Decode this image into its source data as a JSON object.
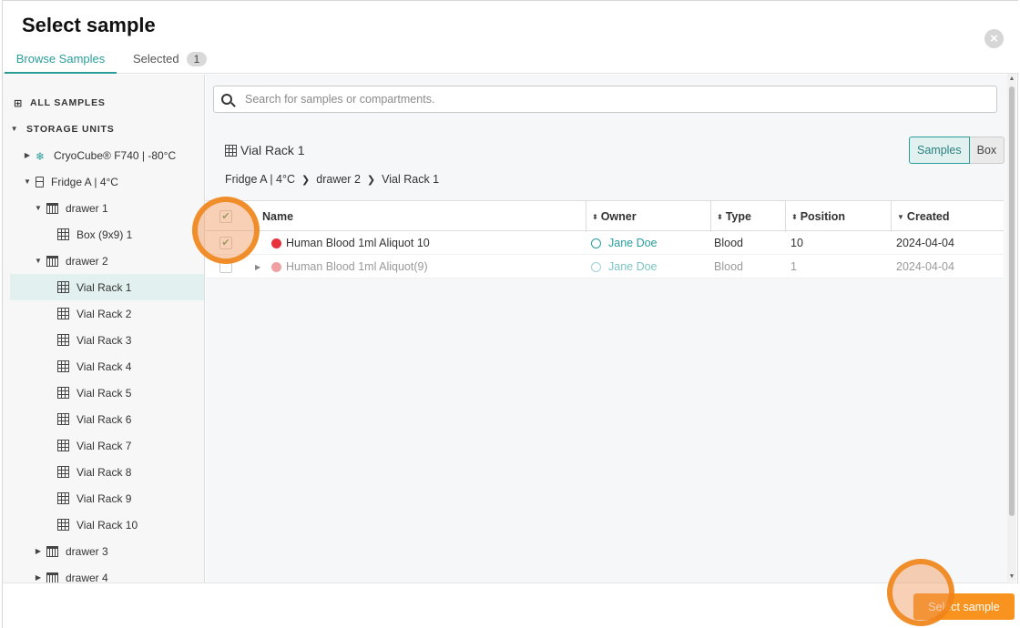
{
  "dialog": {
    "title": "Select sample",
    "close_label": "×",
    "tabs": {
      "browse": "Browse Samples",
      "selected": "Selected",
      "selected_count": "1"
    }
  },
  "sidebar": {
    "all_samples": "ALL SAMPLES",
    "storage_units": "STORAGE UNITS",
    "items": [
      {
        "label": "CryoCube® F740 | -80°C",
        "icon": "freezer-icon"
      },
      {
        "label": "Fridge A | 4°C",
        "icon": "fridge-icon"
      },
      {
        "label": "drawer 1",
        "icon": "drawer-icon"
      },
      {
        "label": "Box (9x9) 1",
        "icon": "grid-icon"
      },
      {
        "label": "drawer 2",
        "icon": "drawer-icon"
      },
      {
        "label": "Vial Rack 1",
        "icon": "grid-icon",
        "active": true
      },
      {
        "label": "Vial Rack 2",
        "icon": "grid-icon"
      },
      {
        "label": "Vial Rack 3",
        "icon": "grid-icon"
      },
      {
        "label": "Vial Rack 4",
        "icon": "grid-icon"
      },
      {
        "label": "Vial Rack 5",
        "icon": "grid-icon"
      },
      {
        "label": "Vial Rack 6",
        "icon": "grid-icon"
      },
      {
        "label": "Vial Rack 7",
        "icon": "grid-icon"
      },
      {
        "label": "Vial Rack 8",
        "icon": "grid-icon"
      },
      {
        "label": "Vial Rack 9",
        "icon": "grid-icon"
      },
      {
        "label": "Vial Rack 10",
        "icon": "grid-icon"
      },
      {
        "label": "drawer 3",
        "icon": "drawer-icon"
      },
      {
        "label": "drawer 4",
        "icon": "drawer-icon"
      }
    ]
  },
  "search": {
    "placeholder": "Search for samples or compartments.",
    "value": ""
  },
  "main": {
    "rack_title": "Vial Rack 1",
    "view_toggle": {
      "samples": "Samples",
      "box": "Box"
    },
    "breadcrumb": [
      "Fridge A | 4°C",
      "drawer 2",
      "Vial Rack 1"
    ],
    "columns": {
      "name": "Name",
      "owner": "Owner",
      "type": "Type",
      "position": "Position",
      "created": "Created"
    },
    "rows": [
      {
        "name": "Human Blood 1ml Aliquot 10",
        "owner": "Jane Doe",
        "type": "Blood",
        "position": "10",
        "created": "2024-04-04",
        "color": "#e8323c",
        "checked": true
      },
      {
        "name": "Human Blood 1ml Aliquot(9)",
        "owner": "Jane Doe",
        "type": "Blood",
        "position": "1",
        "created": "2024-04-04",
        "color": "#f0a0a3",
        "checked": false
      }
    ]
  },
  "footer": {
    "select_button": "Select sample"
  },
  "colors": {
    "accent": "#2a9d9b",
    "primary_button": "#f7931e",
    "highlight": "#f08214"
  }
}
